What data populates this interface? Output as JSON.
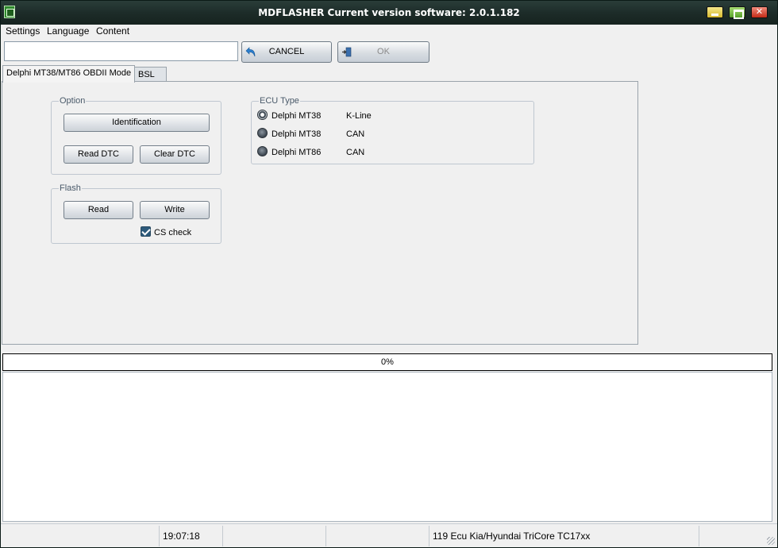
{
  "window": {
    "title": "MDFLASHER  Current version software: 2.0.1.182"
  },
  "menu": {
    "items": [
      "Settings",
      "Language",
      "Content"
    ]
  },
  "toolbar": {
    "input_value": "",
    "cancel_label": "CANCEL",
    "ok_label": "OK"
  },
  "tabs": [
    {
      "label": "Delphi MT38/MT86  OBDII Mode",
      "active": true
    },
    {
      "label": "BSL",
      "active": false
    }
  ],
  "option_group": {
    "legend": "Option",
    "identification_label": "Identification",
    "read_dtc_label": "Read DTC",
    "clear_dtc_label": "Clear DTC"
  },
  "flash_group": {
    "legend": "Flash",
    "read_label": "Read",
    "write_label": "Write",
    "cs_check_label": "CS check",
    "cs_check_checked": true
  },
  "ecu_group": {
    "legend": "ECU Type",
    "options": [
      {
        "name": "Delphi MT38",
        "protocol": "K-Line",
        "selected": true
      },
      {
        "name": "Delphi MT38",
        "protocol": "CAN",
        "selected": false
      },
      {
        "name": "Delphi MT86",
        "protocol": "CAN",
        "selected": false
      }
    ]
  },
  "progress": {
    "text": "0%",
    "value": 0
  },
  "statusbar": {
    "time": "19:07:18",
    "ecu_info": "119 Ecu Kia/Hyundai TriCore TC17xx"
  },
  "colors": {
    "titlebar": "#1d2c29",
    "progress_fill": "#3b78c2"
  }
}
